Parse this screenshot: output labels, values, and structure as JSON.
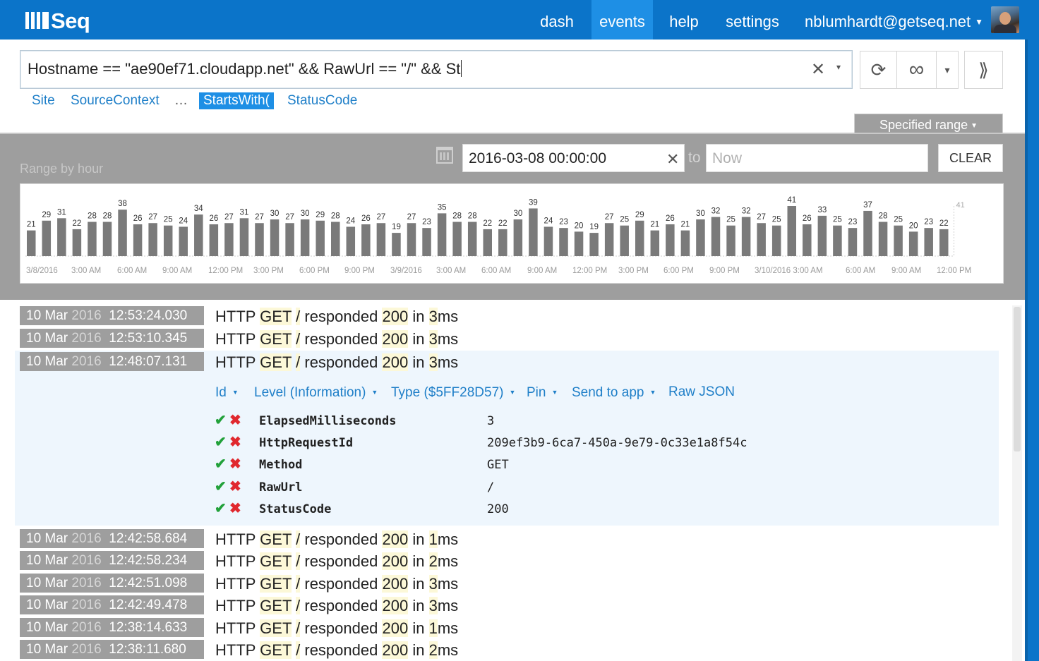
{
  "header": {
    "logo_text": "Seq",
    "nav": [
      {
        "label": "dash"
      },
      {
        "label": "events",
        "active": true
      },
      {
        "label": "help"
      },
      {
        "label": "settings"
      }
    ],
    "user": "nblumhardt@getseq.net",
    "colors": {
      "bar": "#0b74c9",
      "active": "#1e8fe5"
    }
  },
  "query": {
    "text": "Hostname == \"ae90ef71.cloudapp.net\" && RawUrl == \"/\" && St",
    "clear_icon": "✕",
    "dropdown_icon": "▾"
  },
  "toolbar": {
    "refresh_icon": "⟳",
    "tail_icon": "∞",
    "dropdown_icon": "▾",
    "expand_icon": "⟫"
  },
  "suggestions": [
    "Site",
    "SourceContext",
    "…",
    "StartsWith(",
    "StatusCode"
  ],
  "range": {
    "tab_label": "Specified range",
    "title": "Range by hour",
    "from_value": "2016-03-08 00:00:00",
    "to_label": "to",
    "to_placeholder": "Now",
    "clear_label": "CLEAR"
  },
  "chart_data": {
    "type": "bar",
    "values": [
      21,
      29,
      31,
      22,
      28,
      28,
      38,
      26,
      27,
      25,
      24,
      34,
      26,
      27,
      31,
      27,
      30,
      27,
      30,
      29,
      28,
      24,
      26,
      27,
      19,
      27,
      23,
      35,
      28,
      28,
      22,
      22,
      30,
      39,
      24,
      23,
      20,
      19,
      27,
      25,
      29,
      21,
      26,
      21,
      30,
      32,
      25,
      32,
      27,
      25,
      41,
      26,
      33,
      25,
      23,
      37,
      28,
      25,
      20,
      23,
      22
    ],
    "max_label": "41",
    "ylim": [
      0,
      41
    ],
    "x_tick_labels": [
      "3/8/2016",
      "3:00 AM",
      "6:00 AM",
      "9:00 AM",
      "12:00 PM",
      "3:00 PM",
      "6:00 PM",
      "9:00 PM",
      "3/9/2016",
      "3:00 AM",
      "6:00 AM",
      "9:00 AM",
      "12:00 PM",
      "3:00 PM",
      "6:00 PM",
      "9:00 PM",
      "3/10/2016 3:00 AM",
      "6:00 AM",
      "9:00 AM",
      "12:00 PM"
    ],
    "bar_color": "#7a7a7a",
    "grid": false
  },
  "events": [
    {
      "day": "10 Mar",
      "year": "2016",
      "time": "12:53:24.030",
      "ms": "3"
    },
    {
      "day": "10 Mar",
      "year": "2016",
      "time": "12:53:10.345",
      "ms": "3"
    },
    {
      "day": "10 Mar",
      "year": "2016",
      "time": "12:48:07.131",
      "ms": "3",
      "expanded": true
    },
    {
      "day": "10 Mar",
      "year": "2016",
      "time": "12:42:58.684",
      "ms": "1"
    },
    {
      "day": "10 Mar",
      "year": "2016",
      "time": "12:42:58.234",
      "ms": "2"
    },
    {
      "day": "10 Mar",
      "year": "2016",
      "time": "12:42:51.098",
      "ms": "3"
    },
    {
      "day": "10 Mar",
      "year": "2016",
      "time": "12:42:49.478",
      "ms": "3"
    },
    {
      "day": "10 Mar",
      "year": "2016",
      "time": "12:38:14.633",
      "ms": "1"
    },
    {
      "day": "10 Mar",
      "year": "2016",
      "time": "12:38:11.680",
      "ms": "2"
    }
  ],
  "message": {
    "prefix": "HTTP",
    "method": "GET",
    "path": "/",
    "mid": "responded",
    "status": "200",
    "in": "in",
    "unit": "ms"
  },
  "detail": {
    "tabs": [
      "Id",
      "Level (Information)",
      "Type ($5FF28D57)",
      "Pin",
      "Send to app",
      "Raw JSON"
    ],
    "properties": [
      {
        "name": "ElapsedMilliseconds",
        "value": "3"
      },
      {
        "name": "HttpRequestId",
        "value": "209ef3b9-6ca7-450a-9e79-0c33e1a8f54c"
      },
      {
        "name": "Method",
        "value": "GET"
      },
      {
        "name": "RawUrl",
        "value": "/"
      },
      {
        "name": "StatusCode",
        "value": "200"
      }
    ],
    "include_icon": "✔",
    "exclude_icon": "✖"
  }
}
